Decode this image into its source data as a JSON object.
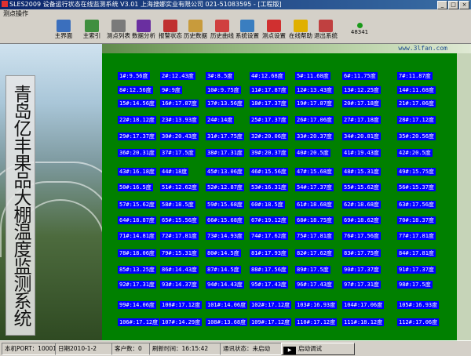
{
  "window": {
    "title": "SLES2009 设备运行状态在线监测系统 V3.01 上海搜娜实业有限公司 021-51083595 - [工程版]"
  },
  "menu": {
    "items": [
      "测点操作"
    ]
  },
  "toolbar": {
    "items": [
      {
        "label": "主界面",
        "icon": "main-screen-icon",
        "color": "#3b6fbd"
      },
      {
        "label": "主索引",
        "icon": "main-index-icon",
        "color": "#3f8f3f"
      },
      {
        "label": "测点列表",
        "icon": "point-list-icon",
        "color": "#7a7a7a"
      },
      {
        "label": "数据分析",
        "icon": "data-analysis-icon",
        "color": "#6a2fa0"
      },
      {
        "label": "报警状态",
        "icon": "alarm-status-icon",
        "color": "#c03030"
      },
      {
        "label": "历史数据",
        "icon": "history-data-icon",
        "color": "#c89b3c"
      },
      {
        "label": "历史曲线",
        "icon": "history-curve-icon",
        "color": "#d04040"
      },
      {
        "label": "系统设置",
        "icon": "system-settings-icon",
        "color": "#3a7ec0"
      },
      {
        "label": "测点设置",
        "icon": "point-settings-icon",
        "color": "#d03030"
      },
      {
        "label": "在线帮助",
        "icon": "online-help-icon",
        "color": "#e0b000"
      },
      {
        "label": "退出系统",
        "icon": "exit-system-icon",
        "color": "#c04040"
      }
    ],
    "online_count": "48341"
  },
  "side_title": "青岛亿丰果品大棚温度监测系统",
  "watermark": "www.3lfan.com",
  "readings": [
    "1#:9.56度",
    "2#:12.43度",
    "3#:8.5度",
    "4#:12.68度",
    "5#:11.68度",
    "6#:11.75度",
    "7#:11.87度",
    "8#:12.56度",
    "9#:9度",
    "10#:9.75度",
    "11#:17.87度",
    "12#:13.43度",
    "13#:12.25度",
    "14#:11.68度",
    "15#:14.56度",
    "16#:17.87度",
    "17#:13.56度",
    "18#:17.37度",
    "19#:17.87度",
    "20#:17.18度",
    "21#:17.06度",
    "22#:18.12度",
    "23#:13.93度",
    "24#:14度",
    "25#:17.37度",
    "26#:17.06度",
    "27#:17.18度",
    "28#:17.12度",
    "29#:17.37度",
    "30#:20.43度",
    "31#:17.75度",
    "32#:20.06度",
    "33#:20.37度",
    "34#:20.81度",
    "35#:20.56度",
    "36#:20.31度",
    "37#:17.5度",
    "38#:17.31度",
    "39#:20.37度",
    "40#:20.5度",
    "41#:19.43度",
    "42#:20.5度",
    "43#:16.18度",
    "44#:18度",
    "45#:13.06度",
    "46#:15.56度",
    "47#:15.68度",
    "48#:15.31度",
    "49#:15.75度",
    "50#:16.5度",
    "51#:12.62度",
    "52#:12.87度",
    "53#:16.31度",
    "54#:17.37度",
    "55#:15.62度",
    "56#:15.37度",
    "57#:15.62度",
    "58#:18.5度",
    "59#:15.68度",
    "60#:18.5度",
    "61#:18.68度",
    "62#:18.68度",
    "63#:17.56度",
    "64#:18.87度",
    "65#:15.56度",
    "66#:15.68度",
    "67#:19.12度",
    "68#:18.75度",
    "69#:18.62度",
    "70#:18.37度",
    "71#:14.81度",
    "72#:17.81度",
    "73#:14.93度",
    "74#:17.62度",
    "75#:17.81度",
    "76#:17.56度",
    "77#:17.81度",
    "78#:18.06度",
    "79#:15.31度",
    "80#:14.5度",
    "81#:17.93度",
    "82#:17.62度",
    "83#:17.75度",
    "84#:17.81度",
    "85#:13.25度",
    "86#:14.43度",
    "87#:14.5度",
    "88#:17.56度",
    "89#:17.5度",
    "90#:17.37度",
    "91#:17.37度",
    "92#:17.31度",
    "93#:14.37度",
    "94#:14.43度",
    "95#:17.43度",
    "96#:17.43度",
    "97#:17.31度",
    "98#:17.5度",
    "99#:14.06度",
    "100#:17.12度",
    "101#:14.06度",
    "102#:17.12度",
    "103#:16.93度",
    "104#:17.06度",
    "105#:16.93度",
    "106#:17.12度",
    "107#:14.29度",
    "108#:13.68度",
    "109#:17.12度",
    "110#:17.12度",
    "111#:18.12度",
    "112#:17.06度"
  ],
  "status": {
    "port": "本机PORT：10001",
    "date": "日期2010-1-2",
    "clients": "客户数：0",
    "refresh_time": "刷新时间：16:15:42",
    "comm_status": "通讯状态：未启动",
    "start_button": "启动调试"
  }
}
